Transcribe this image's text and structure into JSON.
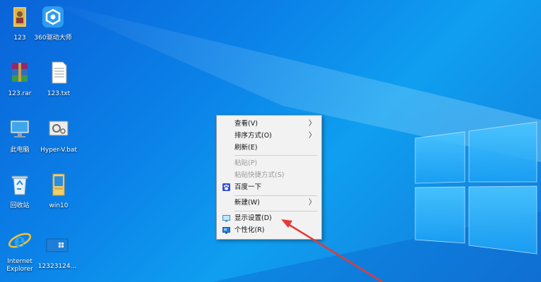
{
  "desktop": {
    "icons": [
      {
        "label": "123",
        "icon": "folder-person-icon"
      },
      {
        "label": "360驱动大师",
        "icon": "driver-master-icon"
      },
      {
        "label": "123.rar",
        "icon": "winrar-archive-icon"
      },
      {
        "label": "123.txt",
        "icon": "text-file-icon"
      },
      {
        "label": "此电脑",
        "icon": "computer-icon"
      },
      {
        "label": "Hyper-V.bat",
        "icon": "batch-file-icon"
      },
      {
        "label": "回收站",
        "icon": "recycle-bin-icon"
      },
      {
        "label": "win10",
        "icon": "folder-icon"
      },
      {
        "label": "Internet\nExplorer",
        "icon": "internet-explorer-icon"
      },
      {
        "label": "12323124...",
        "icon": "image-file-icon"
      }
    ]
  },
  "context_menu": {
    "items": [
      {
        "label": "查看(V)",
        "submenu": true,
        "enabled": true
      },
      {
        "label": "排序方式(O)",
        "submenu": true,
        "enabled": true
      },
      {
        "label": "刷新(E)",
        "submenu": false,
        "enabled": true
      },
      {
        "label": "粘贴(P)",
        "submenu": false,
        "enabled": false
      },
      {
        "label": "粘贴快捷方式(S)",
        "submenu": false,
        "enabled": false
      },
      {
        "label": "百度一下",
        "submenu": false,
        "enabled": true,
        "icon": "baidu-paw-icon"
      },
      {
        "label": "新建(W)",
        "submenu": true,
        "enabled": true
      },
      {
        "label": "显示设置(D)",
        "submenu": false,
        "enabled": true,
        "icon": "display-icon"
      },
      {
        "label": "个性化(R)",
        "submenu": false,
        "enabled": true,
        "icon": "personalize-icon"
      }
    ],
    "submenu_glyph": "〉"
  },
  "colors": {
    "desktop_bg": "#0b82e8",
    "menu_bg": "#f2f2f2",
    "annotation_arrow": "#e53935"
  }
}
